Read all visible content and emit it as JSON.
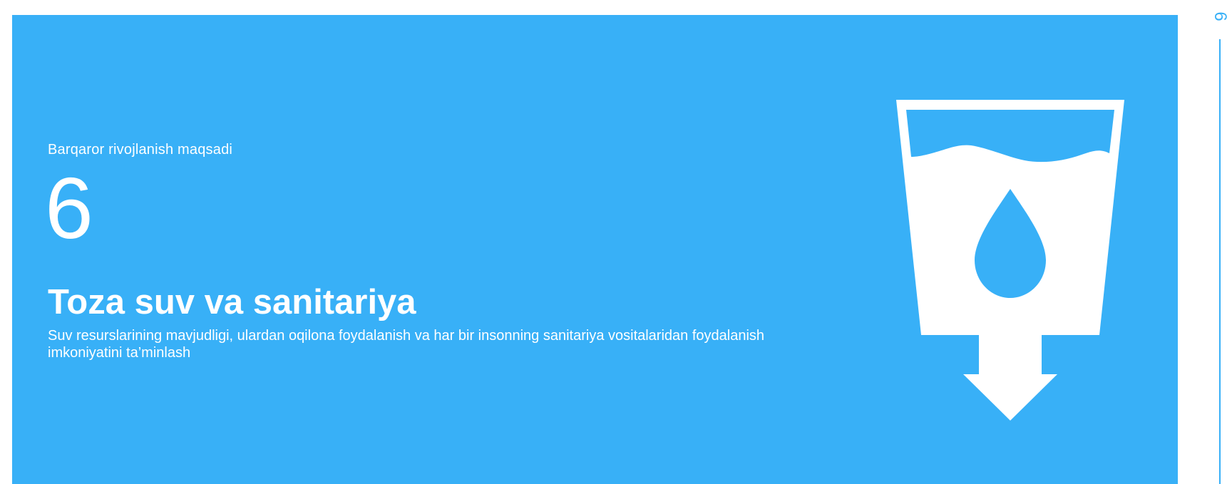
{
  "goal": {
    "eyebrow": "Barqaror rivojlanish maqsadi",
    "number": "6",
    "title": "Toza suv va sanitariya",
    "description": "Suv resurslarining mavjudligi, ulardan oqilona foydalanish va har bir insonning sanitariya vositalaridan foydalanish imkoniyatini ta’minlash",
    "icon": "water-glass-drop-arrow-icon"
  },
  "side_nav": {
    "number": "6"
  },
  "colors": {
    "background": "#38b0f7",
    "text": "#ffffff",
    "accent": "#38b0f7"
  }
}
